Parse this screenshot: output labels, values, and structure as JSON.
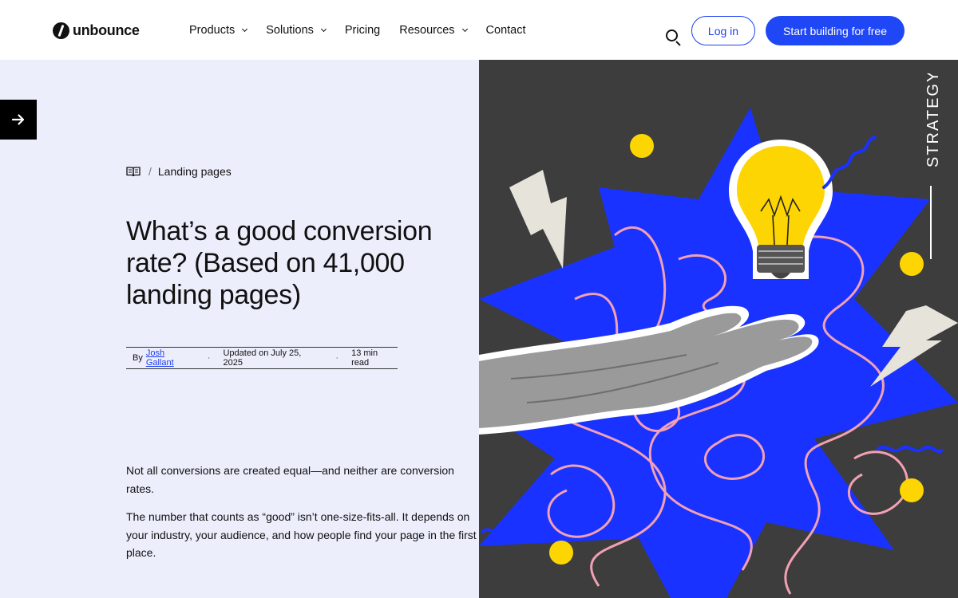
{
  "header": {
    "logo_text": "unbounce",
    "nav": [
      {
        "label": "Products",
        "has_dropdown": true
      },
      {
        "label": "Solutions",
        "has_dropdown": true
      },
      {
        "label": "Pricing",
        "has_dropdown": false
      },
      {
        "label": "Resources",
        "has_dropdown": true
      },
      {
        "label": "Contact",
        "has_dropdown": false
      }
    ],
    "login_label": "Log in",
    "cta_label": "Start building for free"
  },
  "article": {
    "breadcrumb_category": "Landing pages",
    "title": "What’s a good conversion rate? (Based on 41,000 landing pages)",
    "meta": {
      "by_label": "By",
      "author": "Josh Gallant",
      "updated": "Updated on July 25, 2025",
      "read_time": "13 min read"
    },
    "intro": [
      "Not all conversions are created equal—and neither are conversion rates.",
      "The number that counts as “good” isn’t one-size-fits-all. It depends on your industry, your audience, and how people find your page in the first place."
    ]
  },
  "hero": {
    "tag": "STRATEGY"
  },
  "colors": {
    "brand_blue": "#1f47f5",
    "panel_bg": "#eceefc",
    "hero_bg": "#3d3d3d",
    "burst_blue": "#1a32ff",
    "scribble_pink": "#f2a0b4",
    "bulb_yellow": "#fdd503"
  }
}
